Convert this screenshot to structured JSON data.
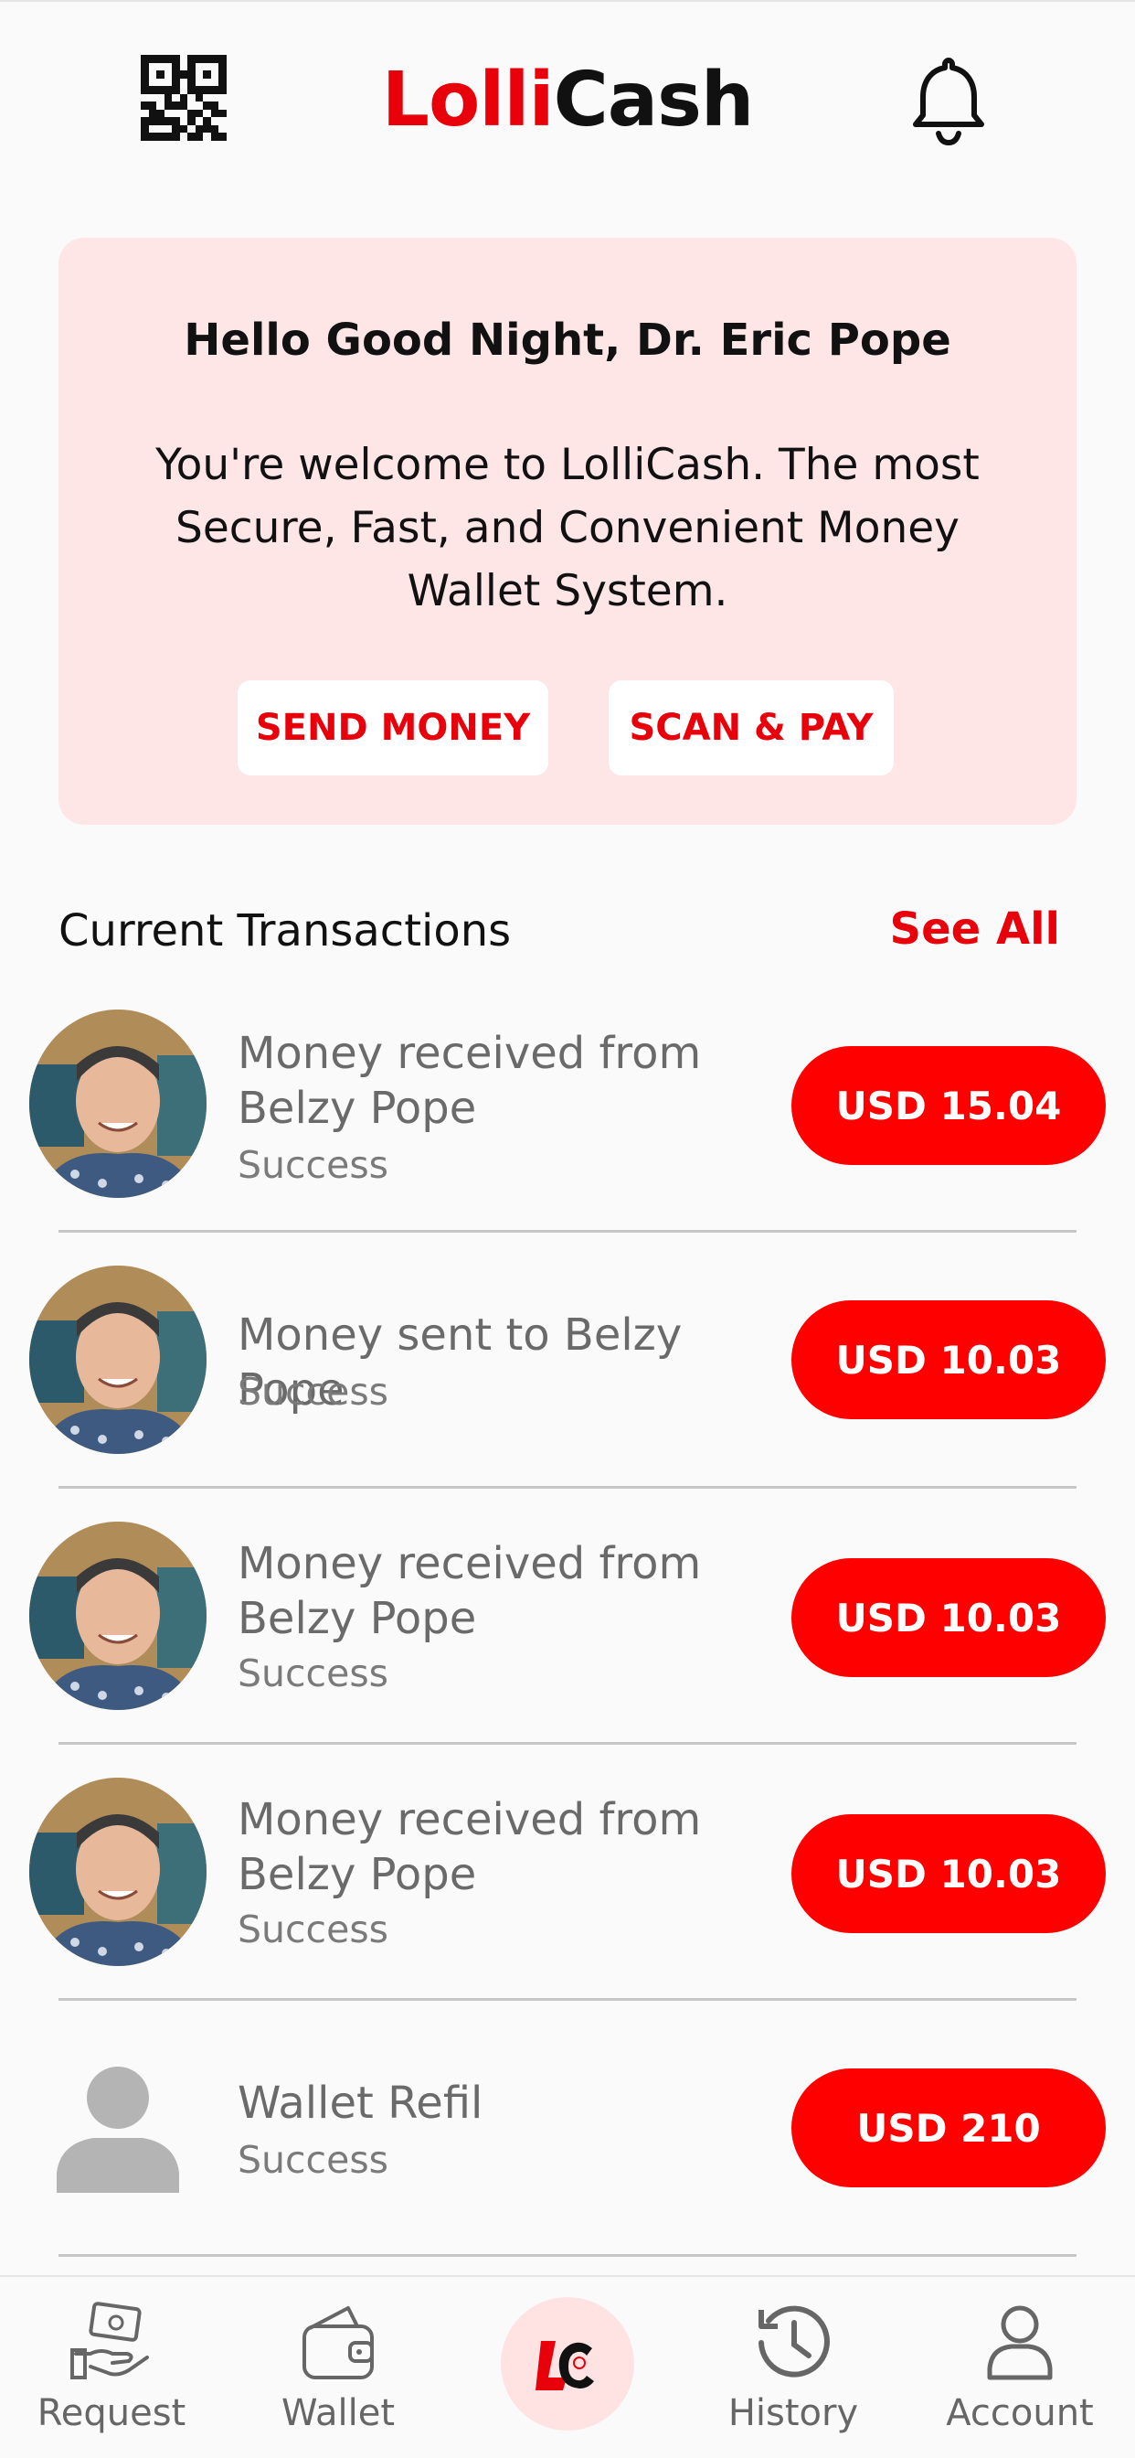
{
  "header": {
    "brand_part1": "Lolli",
    "brand_part2": "Cash",
    "qr_icon": "qr-code-icon",
    "bell_icon": "bell-icon"
  },
  "welcome": {
    "greeting": "Hello Good Night, Dr. Eric Pope",
    "message": "You're welcome to LolliCash. The most Secure, Fast, and Convenient Money Wallet System.",
    "send_label": "SEND MONEY",
    "scan_label": "SCAN & PAY"
  },
  "transactions": {
    "title": "Current Transactions",
    "see_all": "See All",
    "items": [
      {
        "title": "Money received from Belzy Pope",
        "status": "Success",
        "amount": "USD 15.04"
      },
      {
        "title": "Money sent to Belzy Pope",
        "status": "Success",
        "amount": "USD 10.03"
      },
      {
        "title": "Money received from Belzy Pope",
        "status": "Success",
        "amount": "USD 10.03"
      },
      {
        "title": "Money received from Belzy Pope",
        "status": "Success",
        "amount": "USD 10.03"
      },
      {
        "title": "Wallet Refil",
        "status": "Success",
        "amount": "USD 210"
      }
    ]
  },
  "nav": {
    "items": [
      {
        "label": "Request",
        "icon": "hand-money-icon"
      },
      {
        "label": "Wallet",
        "icon": "wallet-icon"
      },
      {
        "label": "",
        "icon": "lollicash-logo-icon"
      },
      {
        "label": "History",
        "icon": "history-icon"
      },
      {
        "label": "Account",
        "icon": "user-icon"
      }
    ]
  },
  "colors": {
    "accent": "#e8000b",
    "amount_pill": "#ff0000",
    "card_bg": "#ffe6e6"
  }
}
